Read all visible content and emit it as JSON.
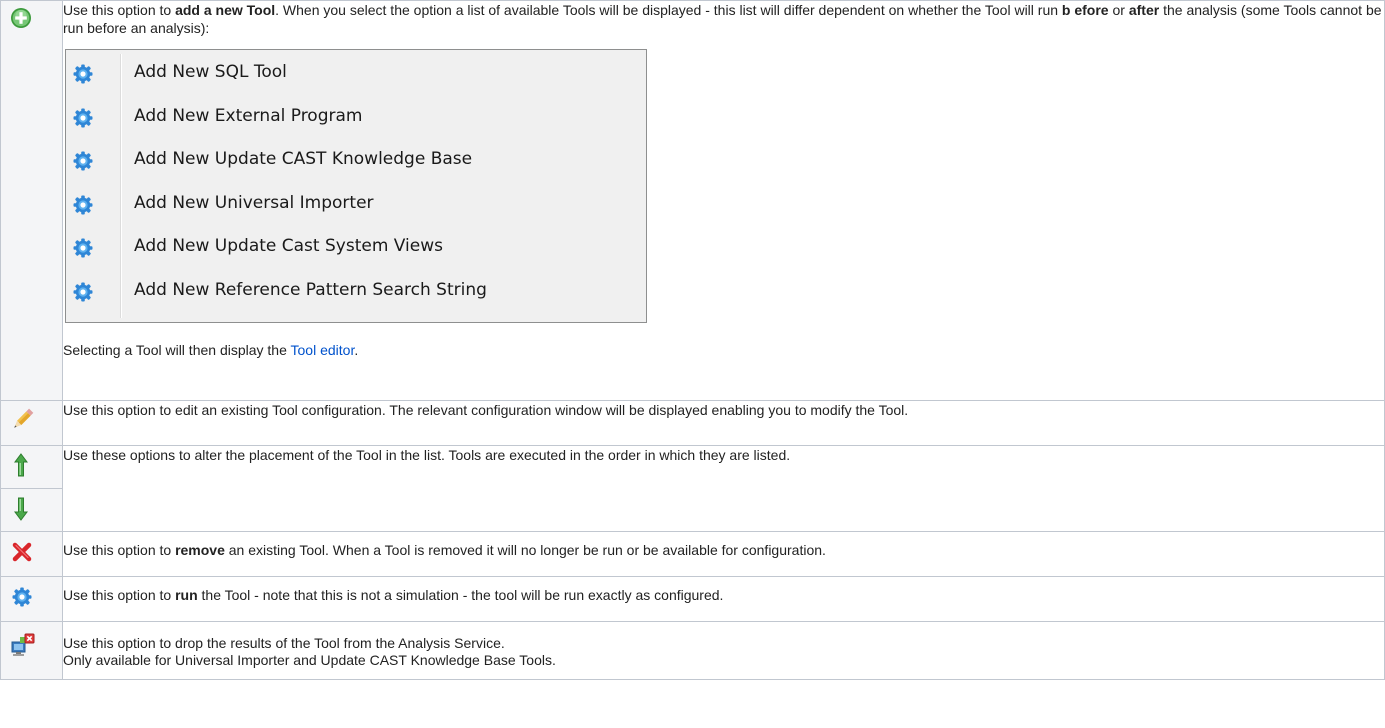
{
  "rows": {
    "add": {
      "text_1": "Use this option to ",
      "bold_1": "add a new Tool",
      "text_2": ". When you select the option a list of available Tools will be displayed - this list will differ dependent on whether the Tool will run ",
      "bold_2": "b efore",
      "text_3": " or ",
      "bold_3": "after",
      "text_4": " the analysis (some Tools cannot be run before an analysis):",
      "menu_items": [
        "Add New SQL Tool",
        "Add New External Program",
        "Add New Update CAST Knowledge Base",
        "Add New Universal Importer",
        "Add New Update Cast System Views",
        "Add New Reference Pattern Search String"
      ],
      "after_text": "Selecting a Tool will then display the ",
      "link_text": "Tool editor",
      "after_end": "."
    },
    "edit": {
      "text": "Use this option to edit an existing Tool configuration. The relevant configuration window will be displayed enabling you to modify the Tool."
    },
    "move": {
      "text": "Use these options to alter the placement of the Tool in the list. Tools are executed in the order in which they are listed."
    },
    "remove": {
      "text_1": "Use this option to ",
      "bold": "remove",
      "text_2": " an existing Tool. When a Tool is removed it will no longer be run or be available for configuration."
    },
    "run": {
      "text_1": "Use this option to ",
      "bold": "run",
      "text_2": " the Tool - note that this is not a simulation - the tool will be run exactly as configured."
    },
    "drop": {
      "line_1": "Use this option to drop the results of the Tool from the Analysis Service.",
      "line_2": "Only available for Universal Importer and Update CAST Knowledge Base Tools."
    }
  },
  "icons": {
    "add": "add-circle-icon",
    "edit": "pencil-icon",
    "up": "arrow-up-icon",
    "down": "arrow-down-icon",
    "remove": "red-x-icon",
    "run": "blue-gear-icon",
    "drop": "drop-results-icon"
  },
  "colors": {
    "link": "#0052cc",
    "icon_cell_bg": "#f4f5f7",
    "border": "#c1c7d0"
  }
}
